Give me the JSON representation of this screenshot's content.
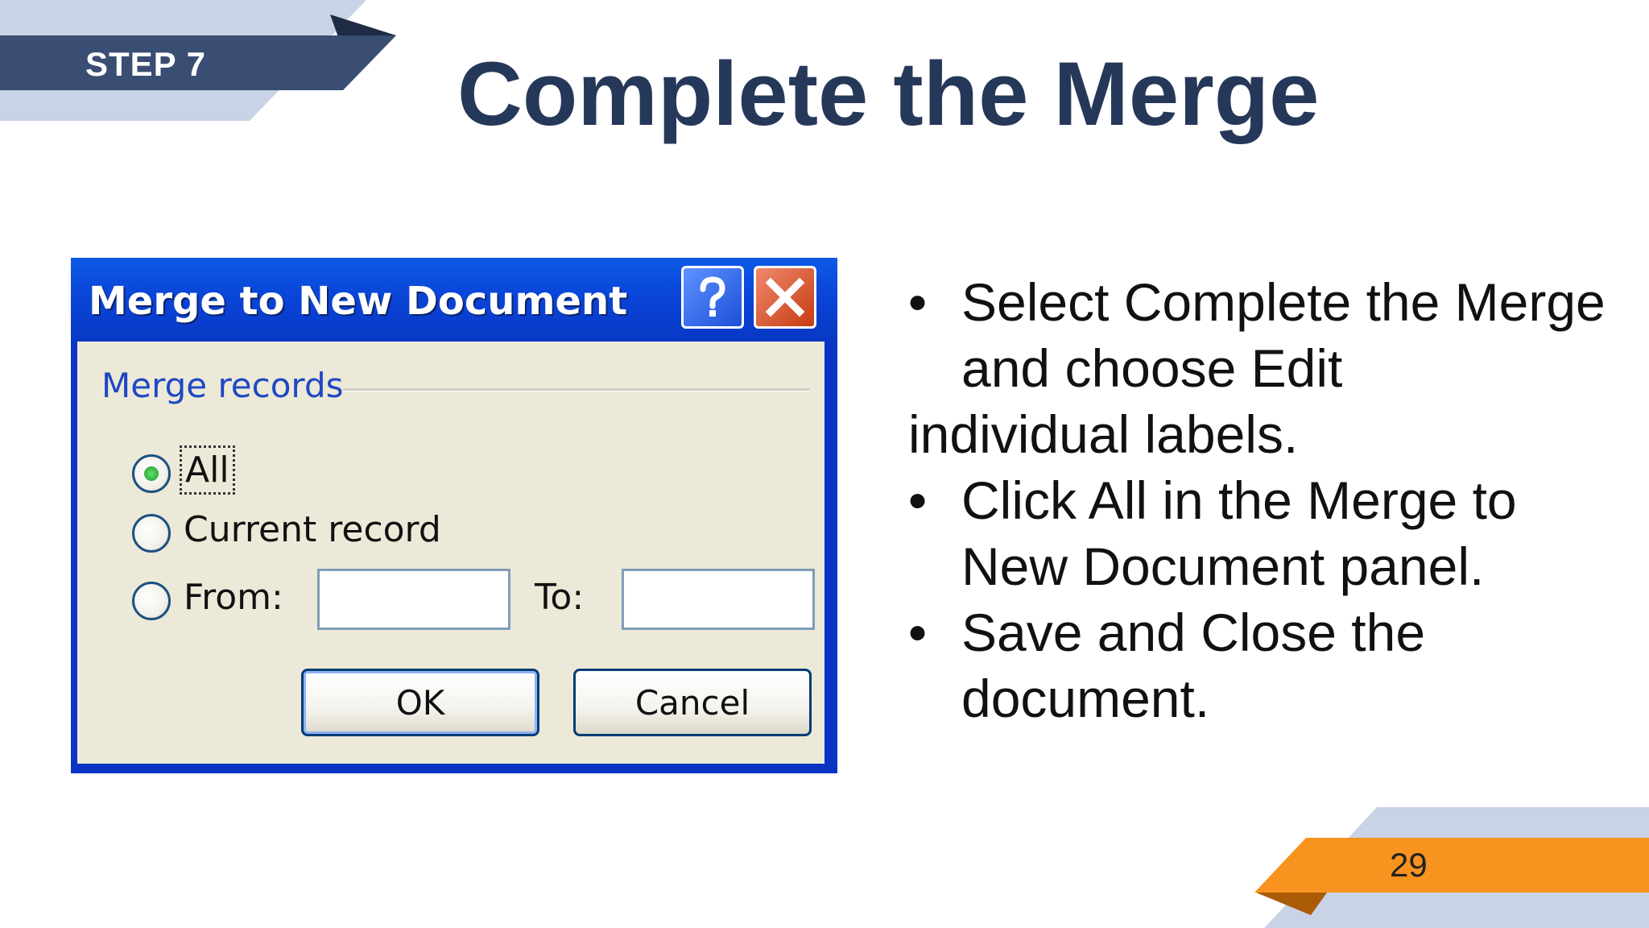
{
  "slide": {
    "step_label": "STEP 7",
    "title": "Complete the Merge",
    "page_number": "29"
  },
  "dialog": {
    "title": "Merge to New Document",
    "help_icon": "question-mark-icon",
    "close_icon": "close-x-icon",
    "group_label": "Merge records",
    "options": {
      "all": "All",
      "current": "Current record",
      "from": "From:",
      "to": "To:"
    },
    "from_value": "",
    "to_value": "",
    "selected_option": "all",
    "buttons": {
      "ok": "OK",
      "cancel": "Cancel"
    }
  },
  "bullets": [
    {
      "text": "Select Complete the Merge and choose Edit",
      "tail": "individual labels."
    },
    {
      "text": "Click All in the Merge to New Document panel.",
      "tail": ""
    },
    {
      "text": "Save and Close the document.",
      "tail": ""
    }
  ],
  "bullet_mark": "•",
  "colors": {
    "navy": "#263859",
    "light_blue": "#c9d3e6",
    "orange": "#f7931e",
    "xp_blue": "#0a45d8"
  }
}
